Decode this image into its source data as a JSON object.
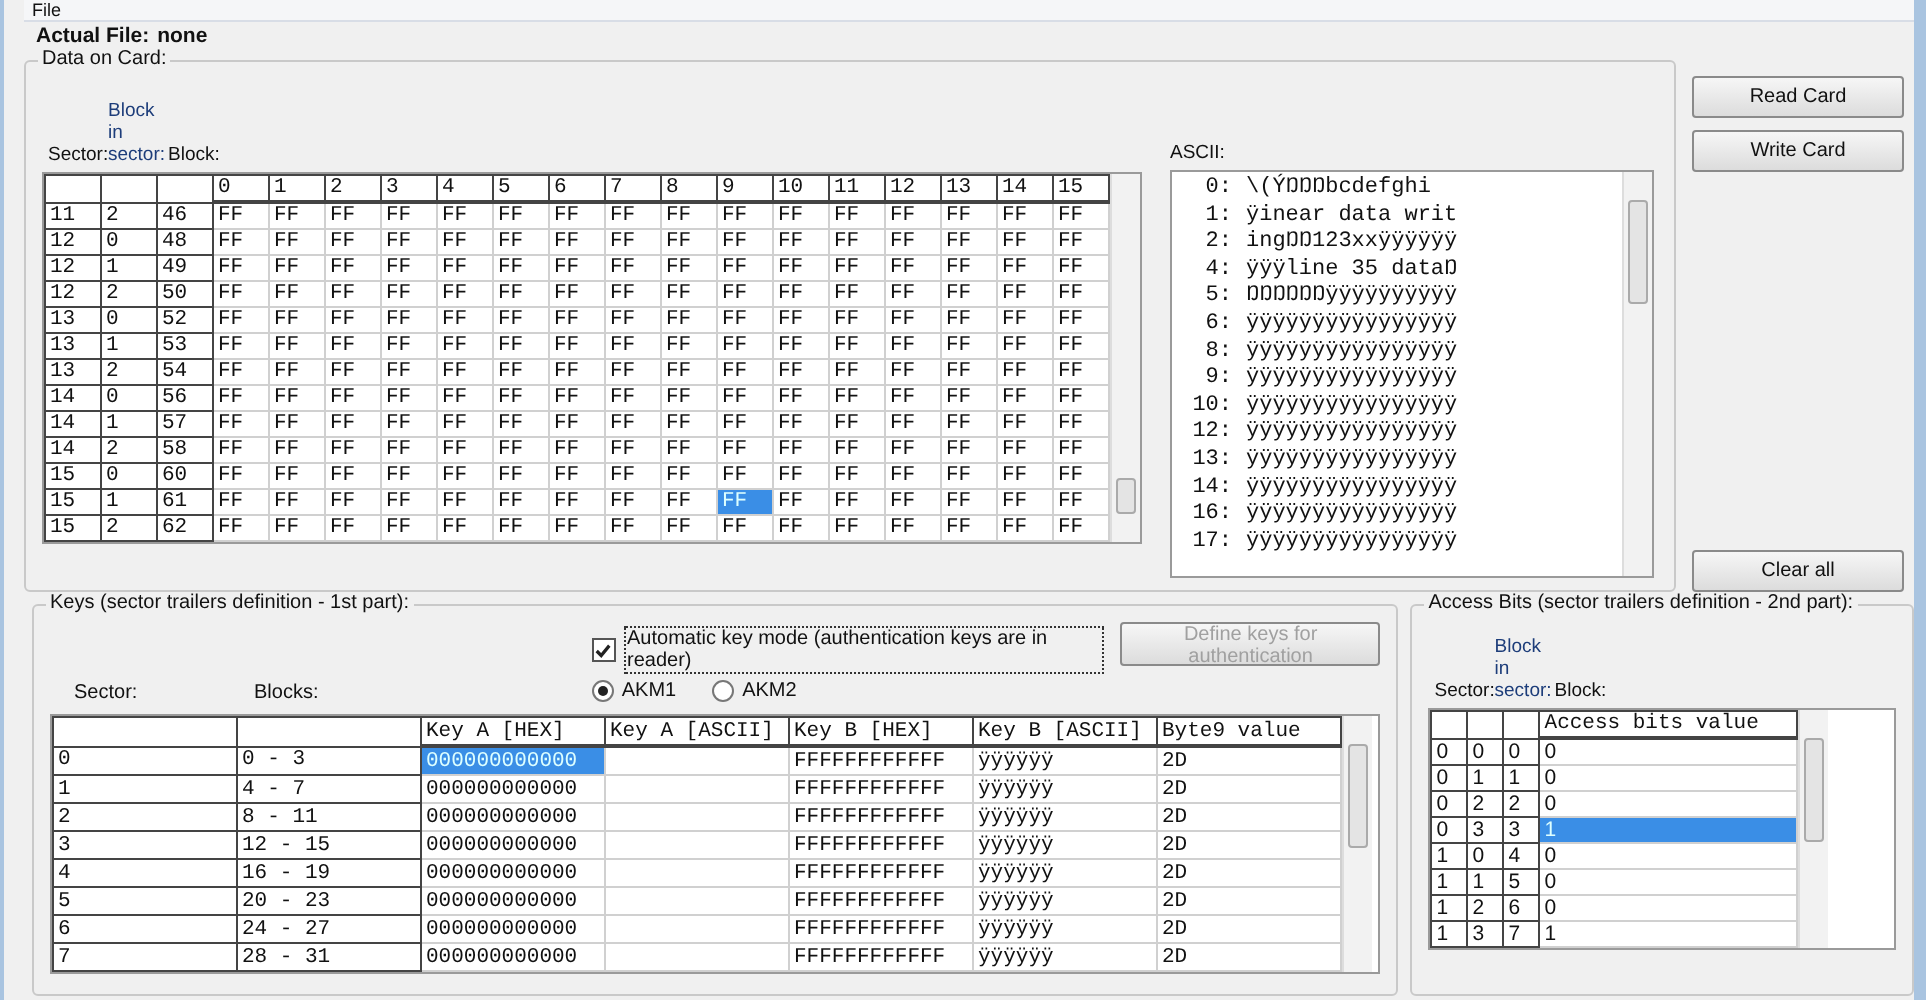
{
  "menu": [
    "File"
  ],
  "actual_file": {
    "label": "Actual File:",
    "value": "none"
  },
  "data_on_card": {
    "title": "Data on Card:",
    "header_labels": {
      "sector": "Sector:",
      "block_in_sector_top": "Block",
      "block_in_sector_mid": "in",
      "block_in_sector": "sector:",
      "block": "Block:"
    },
    "columns": [
      "0",
      "1",
      "2",
      "3",
      "4",
      "5",
      "6",
      "7",
      "8",
      "9",
      "10",
      "11",
      "12",
      "13",
      "14",
      "15"
    ],
    "rows": [
      {
        "sector": "11",
        "block_in_sector": "2",
        "block": "46",
        "cells": [
          {
            "text": "FF",
            "selected": false
          },
          {
            "text": "FF",
            "selected": false
          },
          {
            "text": "FF",
            "selected": false
          },
          {
            "text": "FF",
            "selected": false
          },
          {
            "text": "FF",
            "selected": false
          },
          {
            "text": "FF",
            "selected": false
          },
          {
            "text": "FF",
            "selected": false
          },
          {
            "text": "FF",
            "selected": false
          },
          {
            "text": "FF",
            "selected": false
          },
          {
            "text": "FF",
            "selected": false
          },
          {
            "text": "FF",
            "selected": false
          },
          {
            "text": "FF",
            "selected": false
          },
          {
            "text": "FF",
            "selected": false
          },
          {
            "text": "FF",
            "selected": false
          },
          {
            "text": "FF",
            "selected": false
          },
          {
            "text": "FF",
            "selected": false
          }
        ]
      },
      {
        "sector": "12",
        "block_in_sector": "0",
        "block": "48",
        "cells": [
          {
            "text": "FF",
            "selected": false
          },
          {
            "text": "FF",
            "selected": false
          },
          {
            "text": "FF",
            "selected": false
          },
          {
            "text": "FF",
            "selected": false
          },
          {
            "text": "FF",
            "selected": false
          },
          {
            "text": "FF",
            "selected": false
          },
          {
            "text": "FF",
            "selected": false
          },
          {
            "text": "FF",
            "selected": false
          },
          {
            "text": "FF",
            "selected": false
          },
          {
            "text": "FF",
            "selected": false
          },
          {
            "text": "FF",
            "selected": false
          },
          {
            "text": "FF",
            "selected": false
          },
          {
            "text": "FF",
            "selected": false
          },
          {
            "text": "FF",
            "selected": false
          },
          {
            "text": "FF",
            "selected": false
          },
          {
            "text": "FF",
            "selected": false
          }
        ]
      },
      {
        "sector": "12",
        "block_in_sector": "1",
        "block": "49",
        "cells": [
          {
            "text": "FF",
            "selected": false
          },
          {
            "text": "FF",
            "selected": false
          },
          {
            "text": "FF",
            "selected": false
          },
          {
            "text": "FF",
            "selected": false
          },
          {
            "text": "FF",
            "selected": false
          },
          {
            "text": "FF",
            "selected": false
          },
          {
            "text": "FF",
            "selected": false
          },
          {
            "text": "FF",
            "selected": false
          },
          {
            "text": "FF",
            "selected": false
          },
          {
            "text": "FF",
            "selected": false
          },
          {
            "text": "FF",
            "selected": false
          },
          {
            "text": "FF",
            "selected": false
          },
          {
            "text": "FF",
            "selected": false
          },
          {
            "text": "FF",
            "selected": false
          },
          {
            "text": "FF",
            "selected": false
          },
          {
            "text": "FF",
            "selected": false
          }
        ]
      },
      {
        "sector": "12",
        "block_in_sector": "2",
        "block": "50",
        "cells": [
          {
            "text": "FF",
            "selected": false
          },
          {
            "text": "FF",
            "selected": false
          },
          {
            "text": "FF",
            "selected": false
          },
          {
            "text": "FF",
            "selected": false
          },
          {
            "text": "FF",
            "selected": false
          },
          {
            "text": "FF",
            "selected": false
          },
          {
            "text": "FF",
            "selected": false
          },
          {
            "text": "FF",
            "selected": false
          },
          {
            "text": "FF",
            "selected": false
          },
          {
            "text": "FF",
            "selected": false
          },
          {
            "text": "FF",
            "selected": false
          },
          {
            "text": "FF",
            "selected": false
          },
          {
            "text": "FF",
            "selected": false
          },
          {
            "text": "FF",
            "selected": false
          },
          {
            "text": "FF",
            "selected": false
          },
          {
            "text": "FF",
            "selected": false
          }
        ]
      },
      {
        "sector": "13",
        "block_in_sector": "0",
        "block": "52",
        "cells": [
          {
            "text": "FF",
            "selected": false
          },
          {
            "text": "FF",
            "selected": false
          },
          {
            "text": "FF",
            "selected": false
          },
          {
            "text": "FF",
            "selected": false
          },
          {
            "text": "FF",
            "selected": false
          },
          {
            "text": "FF",
            "selected": false
          },
          {
            "text": "FF",
            "selected": false
          },
          {
            "text": "FF",
            "selected": false
          },
          {
            "text": "FF",
            "selected": false
          },
          {
            "text": "FF",
            "selected": false
          },
          {
            "text": "FF",
            "selected": false
          },
          {
            "text": "FF",
            "selected": false
          },
          {
            "text": "FF",
            "selected": false
          },
          {
            "text": "FF",
            "selected": false
          },
          {
            "text": "FF",
            "selected": false
          },
          {
            "text": "FF",
            "selected": false
          }
        ]
      },
      {
        "sector": "13",
        "block_in_sector": "1",
        "block": "53",
        "cells": [
          {
            "text": "FF",
            "selected": false
          },
          {
            "text": "FF",
            "selected": false
          },
          {
            "text": "FF",
            "selected": false
          },
          {
            "text": "FF",
            "selected": false
          },
          {
            "text": "FF",
            "selected": false
          },
          {
            "text": "FF",
            "selected": false
          },
          {
            "text": "FF",
            "selected": false
          },
          {
            "text": "FF",
            "selected": false
          },
          {
            "text": "FF",
            "selected": false
          },
          {
            "text": "FF",
            "selected": false
          },
          {
            "text": "FF",
            "selected": false
          },
          {
            "text": "FF",
            "selected": false
          },
          {
            "text": "FF",
            "selected": false
          },
          {
            "text": "FF",
            "selected": false
          },
          {
            "text": "FF",
            "selected": false
          },
          {
            "text": "FF",
            "selected": false
          }
        ]
      },
      {
        "sector": "13",
        "block_in_sector": "2",
        "block": "54",
        "cells": [
          {
            "text": "FF",
            "selected": false
          },
          {
            "text": "FF",
            "selected": false
          },
          {
            "text": "FF",
            "selected": false
          },
          {
            "text": "FF",
            "selected": false
          },
          {
            "text": "FF",
            "selected": false
          },
          {
            "text": "FF",
            "selected": false
          },
          {
            "text": "FF",
            "selected": false
          },
          {
            "text": "FF",
            "selected": false
          },
          {
            "text": "FF",
            "selected": false
          },
          {
            "text": "FF",
            "selected": false
          },
          {
            "text": "FF",
            "selected": false
          },
          {
            "text": "FF",
            "selected": false
          },
          {
            "text": "FF",
            "selected": false
          },
          {
            "text": "FF",
            "selected": false
          },
          {
            "text": "FF",
            "selected": false
          },
          {
            "text": "FF",
            "selected": false
          }
        ]
      },
      {
        "sector": "14",
        "block_in_sector": "0",
        "block": "56",
        "cells": [
          {
            "text": "FF",
            "selected": false
          },
          {
            "text": "FF",
            "selected": false
          },
          {
            "text": "FF",
            "selected": false
          },
          {
            "text": "FF",
            "selected": false
          },
          {
            "text": "FF",
            "selected": false
          },
          {
            "text": "FF",
            "selected": false
          },
          {
            "text": "FF",
            "selected": false
          },
          {
            "text": "FF",
            "selected": false
          },
          {
            "text": "FF",
            "selected": false
          },
          {
            "text": "FF",
            "selected": false
          },
          {
            "text": "FF",
            "selected": false
          },
          {
            "text": "FF",
            "selected": false
          },
          {
            "text": "FF",
            "selected": false
          },
          {
            "text": "FF",
            "selected": false
          },
          {
            "text": "FF",
            "selected": false
          },
          {
            "text": "FF",
            "selected": false
          }
        ]
      },
      {
        "sector": "14",
        "block_in_sector": "1",
        "block": "57",
        "cells": [
          {
            "text": "FF",
            "selected": false
          },
          {
            "text": "FF",
            "selected": false
          },
          {
            "text": "FF",
            "selected": false
          },
          {
            "text": "FF",
            "selected": false
          },
          {
            "text": "FF",
            "selected": false
          },
          {
            "text": "FF",
            "selected": false
          },
          {
            "text": "FF",
            "selected": false
          },
          {
            "text": "FF",
            "selected": false
          },
          {
            "text": "FF",
            "selected": false
          },
          {
            "text": "FF",
            "selected": false
          },
          {
            "text": "FF",
            "selected": false
          },
          {
            "text": "FF",
            "selected": false
          },
          {
            "text": "FF",
            "selected": false
          },
          {
            "text": "FF",
            "selected": false
          },
          {
            "text": "FF",
            "selected": false
          },
          {
            "text": "FF",
            "selected": false
          }
        ]
      },
      {
        "sector": "14",
        "block_in_sector": "2",
        "block": "58",
        "cells": [
          {
            "text": "FF",
            "selected": false
          },
          {
            "text": "FF",
            "selected": false
          },
          {
            "text": "FF",
            "selected": false
          },
          {
            "text": "FF",
            "selected": false
          },
          {
            "text": "FF",
            "selected": false
          },
          {
            "text": "FF",
            "selected": false
          },
          {
            "text": "FF",
            "selected": false
          },
          {
            "text": "FF",
            "selected": false
          },
          {
            "text": "FF",
            "selected": false
          },
          {
            "text": "FF",
            "selected": false
          },
          {
            "text": "FF",
            "selected": false
          },
          {
            "text": "FF",
            "selected": false
          },
          {
            "text": "FF",
            "selected": false
          },
          {
            "text": "FF",
            "selected": false
          },
          {
            "text": "FF",
            "selected": false
          },
          {
            "text": "FF",
            "selected": false
          }
        ]
      },
      {
        "sector": "15",
        "block_in_sector": "0",
        "block": "60",
        "cells": [
          {
            "text": "FF",
            "selected": false
          },
          {
            "text": "FF",
            "selected": false
          },
          {
            "text": "FF",
            "selected": false
          },
          {
            "text": "FF",
            "selected": false
          },
          {
            "text": "FF",
            "selected": false
          },
          {
            "text": "FF",
            "selected": false
          },
          {
            "text": "FF",
            "selected": false
          },
          {
            "text": "FF",
            "selected": false
          },
          {
            "text": "FF",
            "selected": false
          },
          {
            "text": "FF",
            "selected": false
          },
          {
            "text": "FF",
            "selected": false
          },
          {
            "text": "FF",
            "selected": false
          },
          {
            "text": "FF",
            "selected": false
          },
          {
            "text": "FF",
            "selected": false
          },
          {
            "text": "FF",
            "selected": false
          },
          {
            "text": "FF",
            "selected": false
          }
        ]
      },
      {
        "sector": "15",
        "block_in_sector": "1",
        "block": "61",
        "cells": [
          {
            "text": "FF",
            "selected": false
          },
          {
            "text": "FF",
            "selected": false
          },
          {
            "text": "FF",
            "selected": false
          },
          {
            "text": "FF",
            "selected": false
          },
          {
            "text": "FF",
            "selected": false
          },
          {
            "text": "FF",
            "selected": false
          },
          {
            "text": "FF",
            "selected": false
          },
          {
            "text": "FF",
            "selected": false
          },
          {
            "text": "FF",
            "selected": false
          },
          {
            "text": "FF",
            "selected": true
          },
          {
            "text": "FF",
            "selected": false
          },
          {
            "text": "FF",
            "selected": false
          },
          {
            "text": "FF",
            "selected": false
          },
          {
            "text": "FF",
            "selected": false
          },
          {
            "text": "FF",
            "selected": false
          },
          {
            "text": "FF",
            "selected": false
          }
        ]
      },
      {
        "sector": "15",
        "block_in_sector": "2",
        "block": "62",
        "cells": [
          {
            "text": "FF",
            "selected": false
          },
          {
            "text": "FF",
            "selected": false
          },
          {
            "text": "FF",
            "selected": false
          },
          {
            "text": "FF",
            "selected": false
          },
          {
            "text": "FF",
            "selected": false
          },
          {
            "text": "FF",
            "selected": false
          },
          {
            "text": "FF",
            "selected": false
          },
          {
            "text": "FF",
            "selected": false
          },
          {
            "text": "FF",
            "selected": false
          },
          {
            "text": "FF",
            "selected": false
          },
          {
            "text": "FF",
            "selected": false
          },
          {
            "text": "FF",
            "selected": false
          },
          {
            "text": "FF",
            "selected": false
          },
          {
            "text": "FF",
            "selected": false
          },
          {
            "text": "FF",
            "selected": false
          },
          {
            "text": "FF",
            "selected": false
          }
        ]
      }
    ],
    "ascii": {
      "label": "ASCII:",
      "lines": [
        {
          "number": "0:",
          "text": "\\(ÝŊŊŊbcdefghi"
        },
        {
          "number": "1:",
          "text": "ÿinear data writ"
        },
        {
          "number": "2:",
          "text": "ingŊŊ123xxÿÿÿÿÿÿ"
        },
        {
          "number": "4:",
          "text": "ÿÿÿline 35 dataŊ"
        },
        {
          "number": "5:",
          "text": "ŊŊŊŊŊŊÿÿÿÿÿÿÿÿÿÿ"
        },
        {
          "number": "6:",
          "text": "ÿÿÿÿÿÿÿÿÿÿÿÿÿÿÿÿ"
        },
        {
          "number": "8:",
          "text": "ÿÿÿÿÿÿÿÿÿÿÿÿÿÿÿÿ"
        },
        {
          "number": "9:",
          "text": "ÿÿÿÿÿÿÿÿÿÿÿÿÿÿÿÿ"
        },
        {
          "number": "10:",
          "text": "ÿÿÿÿÿÿÿÿÿÿÿÿÿÿÿÿ"
        },
        {
          "number": "12:",
          "text": "ÿÿÿÿÿÿÿÿÿÿÿÿÿÿÿÿ"
        },
        {
          "number": "13:",
          "text": "ÿÿÿÿÿÿÿÿÿÿÿÿÿÿÿÿ"
        },
        {
          "number": "14:",
          "text": "ÿÿÿÿÿÿÿÿÿÿÿÿÿÿÿÿ"
        },
        {
          "number": "16:",
          "text": "ÿÿÿÿÿÿÿÿÿÿÿÿÿÿÿÿ"
        },
        {
          "number": "17:",
          "text": "ÿÿÿÿÿÿÿÿÿÿÿÿÿÿÿÿ"
        }
      ]
    }
  },
  "buttons": {
    "read": "Read Card",
    "write": "Write Card",
    "clear": "Clear all"
  },
  "keys": {
    "title": "Keys (sector trailers definition - 1st part):",
    "auto_key_mode": {
      "label": "Automatic key mode (authentication keys are in reader)",
      "checked": true
    },
    "radios": [
      {
        "label": "AKM1",
        "selected": true
      },
      {
        "label": "AKM2",
        "selected": false
      }
    ],
    "define_button": {
      "label": "Define keys for authentication",
      "disabled": true
    },
    "labels": {
      "sector": "Sector:",
      "blocks": "Blocks:"
    },
    "columns": [
      "Key A [HEX]",
      "Key A [ASCII]",
      "Key B [HEX]",
      "Key B [ASCII]",
      "Byte9 value"
    ],
    "rows": [
      {
        "sector": "0",
        "blocks": "0 - 3",
        "key_a_hex": "000000000000",
        "key_b_hex": "FFFFFFFFFFFF",
        "key_b_ascii": "ÿÿÿÿÿÿ",
        "byte9": "2D",
        "selected": true
      },
      {
        "sector": "1",
        "blocks": "4 - 7",
        "key_a_hex": "000000000000",
        "key_b_hex": "FFFFFFFFFFFF",
        "key_b_ascii": "ÿÿÿÿÿÿ",
        "byte9": "2D",
        "selected": false
      },
      {
        "sector": "2",
        "blocks": "8 - 11",
        "key_a_hex": "000000000000",
        "key_b_hex": "FFFFFFFFFFFF",
        "key_b_ascii": "ÿÿÿÿÿÿ",
        "byte9": "2D",
        "selected": false
      },
      {
        "sector": "3",
        "blocks": "12 - 15",
        "key_a_hex": "000000000000",
        "key_b_hex": "FFFFFFFFFFFF",
        "key_b_ascii": "ÿÿÿÿÿÿ",
        "byte9": "2D",
        "selected": false
      },
      {
        "sector": "4",
        "blocks": "16 - 19",
        "key_a_hex": "000000000000",
        "key_b_hex": "FFFFFFFFFFFF",
        "key_b_ascii": "ÿÿÿÿÿÿ",
        "byte9": "2D",
        "selected": false
      },
      {
        "sector": "5",
        "blocks": "20 - 23",
        "key_a_hex": "000000000000",
        "key_b_hex": "FFFFFFFFFFFF",
        "key_b_ascii": "ÿÿÿÿÿÿ",
        "byte9": "2D",
        "selected": false
      },
      {
        "sector": "6",
        "blocks": "24 - 27",
        "key_a_hex": "000000000000",
        "key_b_hex": "FFFFFFFFFFFF",
        "key_b_ascii": "ÿÿÿÿÿÿ",
        "byte9": "2D",
        "selected": false
      },
      {
        "sector": "7",
        "blocks": "28 - 31",
        "key_a_hex": "000000000000",
        "key_b_hex": "FFFFFFFFFFFF",
        "key_b_ascii": "ÿÿÿÿÿÿ",
        "byte9": "2D",
        "selected": false
      }
    ]
  },
  "access_bits": {
    "title": "Access Bits (sector trailers definition - 2nd part):",
    "header_labels": {
      "sector": "Sector:",
      "block_in_sector_top": "Block",
      "block_in_sector_mid": "in",
      "block_in_sector": "sector:",
      "block": "Block:"
    },
    "column": "Access bits value",
    "rows": [
      {
        "sector": "0",
        "block_in_sector": "0",
        "block": "0",
        "value": "0",
        "selected": false
      },
      {
        "sector": "0",
        "block_in_sector": "1",
        "block": "1",
        "value": "0",
        "selected": false
      },
      {
        "sector": "0",
        "block_in_sector": "2",
        "block": "2",
        "value": "0",
        "selected": false
      },
      {
        "sector": "0",
        "block_in_sector": "3",
        "block": "3",
        "value": "1",
        "selected": true
      },
      {
        "sector": "1",
        "block_in_sector": "0",
        "block": "4",
        "value": "0",
        "selected": false
      },
      {
        "sector": "1",
        "block_in_sector": "1",
        "block": "5",
        "value": "0",
        "selected": false
      },
      {
        "sector": "1",
        "block_in_sector": "2",
        "block": "6",
        "value": "0",
        "selected": false
      },
      {
        "sector": "1",
        "block_in_sector": "3",
        "block": "7",
        "value": "1",
        "selected": false
      }
    ]
  }
}
